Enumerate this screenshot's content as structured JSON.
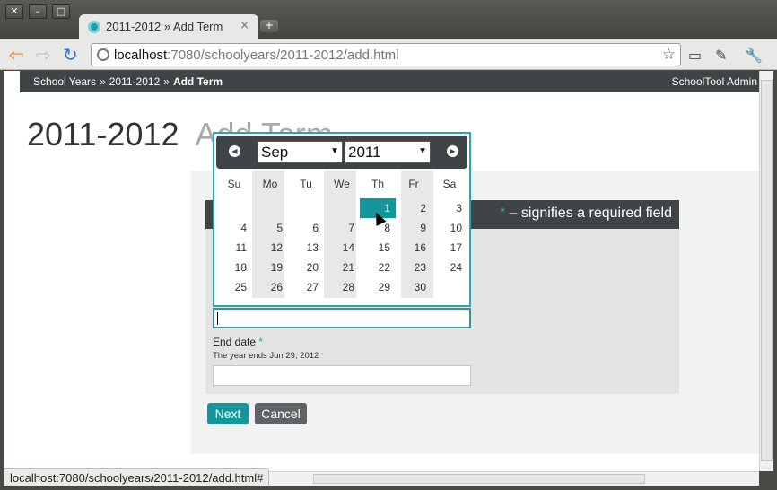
{
  "window": {
    "controls": [
      "✕",
      "–",
      "□"
    ]
  },
  "tab": {
    "title": "2011-2012 » Add Term",
    "close": "×",
    "new_tab": "+"
  },
  "toolbar": {
    "back": "⇦",
    "forward": "⇨",
    "reload": "↻",
    "url_host": "localhost",
    "url_rest": ":7080/schoolyears/2011-2012/add.html",
    "star": "☆",
    "fullscreen": "▭",
    "pin": "✎",
    "wrench": "🔧"
  },
  "breadcrumb": {
    "items": [
      "School Years",
      "2011-2012",
      "Add Term"
    ],
    "sep": "»",
    "brand": "SchoolTool Admin"
  },
  "page": {
    "title": "2011-2012",
    "subtitle": "Add Term"
  },
  "form": {
    "required_note_ast": "*",
    "required_note": " – signifies a required field",
    "end_date_label": "End date",
    "end_date_ast": "*",
    "end_date_hint": "The year ends Jun 29, 2012",
    "start_value": "",
    "end_value": "",
    "next": "Next",
    "cancel": "Cancel"
  },
  "calendar": {
    "prev": "◀",
    "next": "▶",
    "month": "Sep",
    "year": "2011",
    "days_of_week": [
      "Su",
      "Mo",
      "Tu",
      "We",
      "Th",
      "Fr",
      "Sa"
    ],
    "selected_day": "1",
    "weeks": [
      [
        "",
        "",
        "",
        "",
        "1",
        "2",
        "3"
      ],
      [
        "4",
        "5",
        "6",
        "7",
        "8",
        "9",
        "10"
      ],
      [
        "11",
        "12",
        "13",
        "14",
        "15",
        "16",
        "17"
      ],
      [
        "18",
        "19",
        "20",
        "21",
        "22",
        "23",
        "24"
      ],
      [
        "25",
        "26",
        "27",
        "28",
        "29",
        "30",
        ""
      ]
    ]
  },
  "statusbar": {
    "text": "localhost:7080/schoolyears/2011-2012/add.html#"
  },
  "colors": {
    "accent": "#14969c",
    "dark_bar": "#3f4446"
  }
}
